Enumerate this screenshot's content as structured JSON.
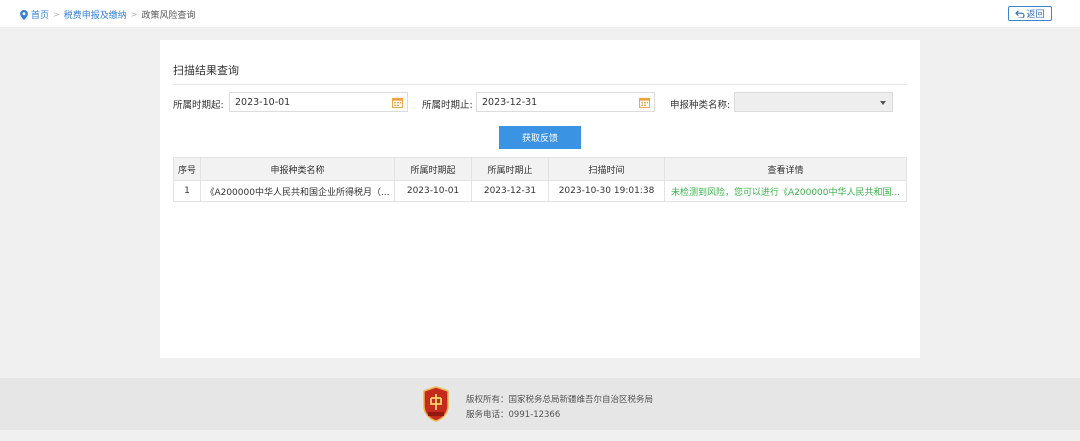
{
  "breadcrumb": {
    "home": "首页",
    "level2": "税费申报及缴纳",
    "current": "政策风险查询",
    "separator": ">"
  },
  "header": {
    "back_label": "返回"
  },
  "panel": {
    "title": "扫描结果查询"
  },
  "filters": {
    "start_label": "所属时期起:",
    "start_value": "2023-10-01",
    "end_label": "所属时期止:",
    "end_value": "2023-12-31",
    "type_label": "申报种类名称:",
    "type_value": ""
  },
  "actions": {
    "fetch_label": "获取反馈"
  },
  "table": {
    "headers": [
      "序号",
      "申报种类名称",
      "所属时期起",
      "所属时期止",
      "扫描时间",
      "查看详情"
    ],
    "rows": [
      {
        "index": "1",
        "name": "《A200000中华人民共和国企业所得税月（...",
        "start": "2023-10-01",
        "end": "2023-12-31",
        "scan_time": "2023-10-30 19:01:38",
        "detail": "未检测到风险，您可以进行《A200000中华人民共和国..."
      }
    ]
  },
  "footer": {
    "copyright": "版权所有：国家税务总局新疆维吾尔自治区税务局",
    "phone": "服务电话：0991-12366"
  },
  "colors": {
    "accent": "#3b93e3",
    "link": "#2f7fd6",
    "success": "#38b24a",
    "logo": "#c62a1f",
    "calendar_icon": "#f0a33a"
  }
}
